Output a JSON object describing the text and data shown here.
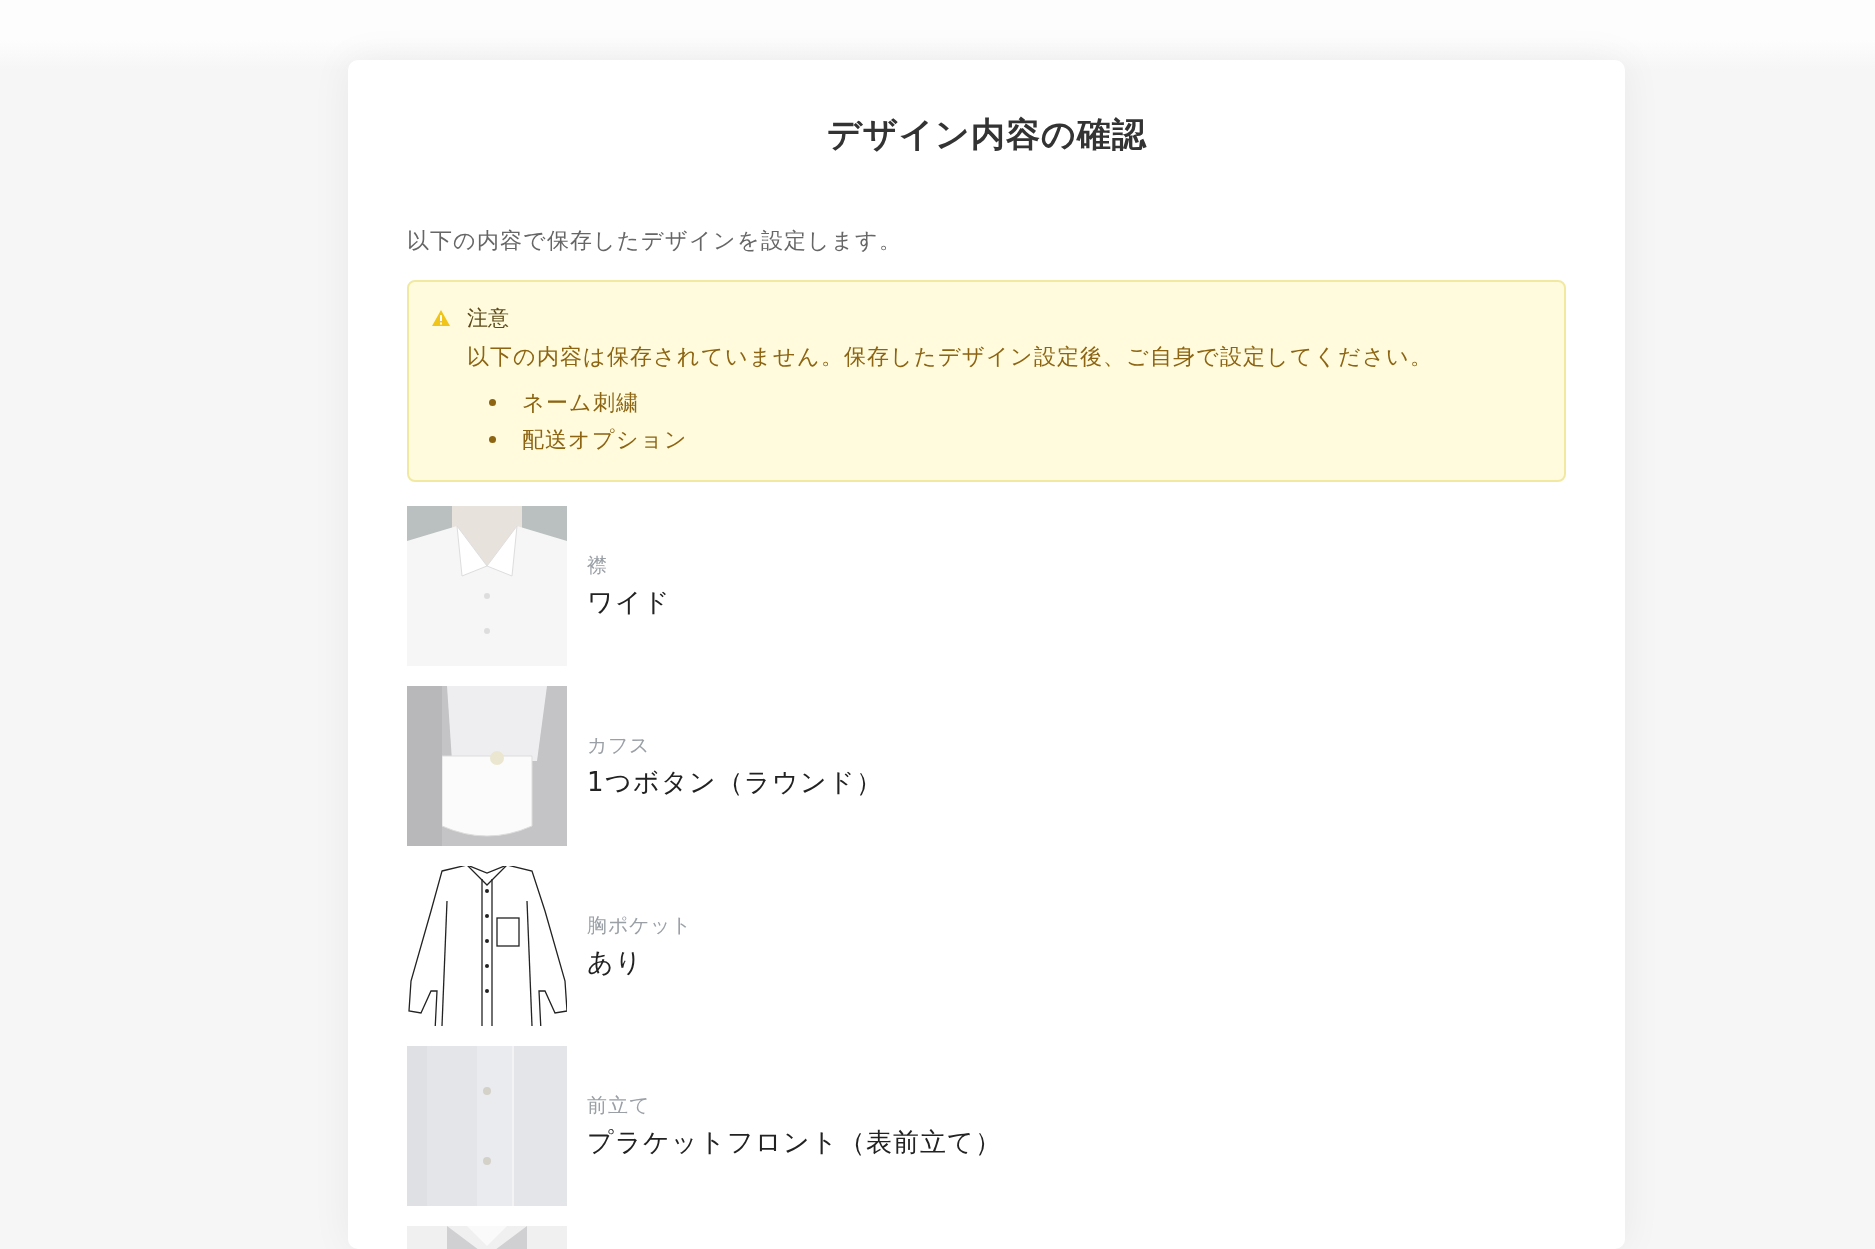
{
  "title": "デザイン内容の確認",
  "intro": "以下の内容で保存したデザインを設定します。",
  "notice": {
    "heading": "注意",
    "message": "以下の内容は保存されていません。保存したデザイン設定後、ご自身で設定してください。",
    "items": [
      "ネーム刺繍",
      "配送オプション"
    ]
  },
  "items": [
    {
      "kind": "picture",
      "label": "襟",
      "value": "ワイド"
    },
    {
      "kind": "picture",
      "label": "カフス",
      "value": "1つボタン（ラウンド）"
    },
    {
      "kind": "drawing",
      "label": "胸ポケット",
      "value": "あり"
    },
    {
      "kind": "picture",
      "label": "前立て",
      "value": "プラケットフロント（表前立て）"
    },
    {
      "kind": "picture"
    }
  ]
}
